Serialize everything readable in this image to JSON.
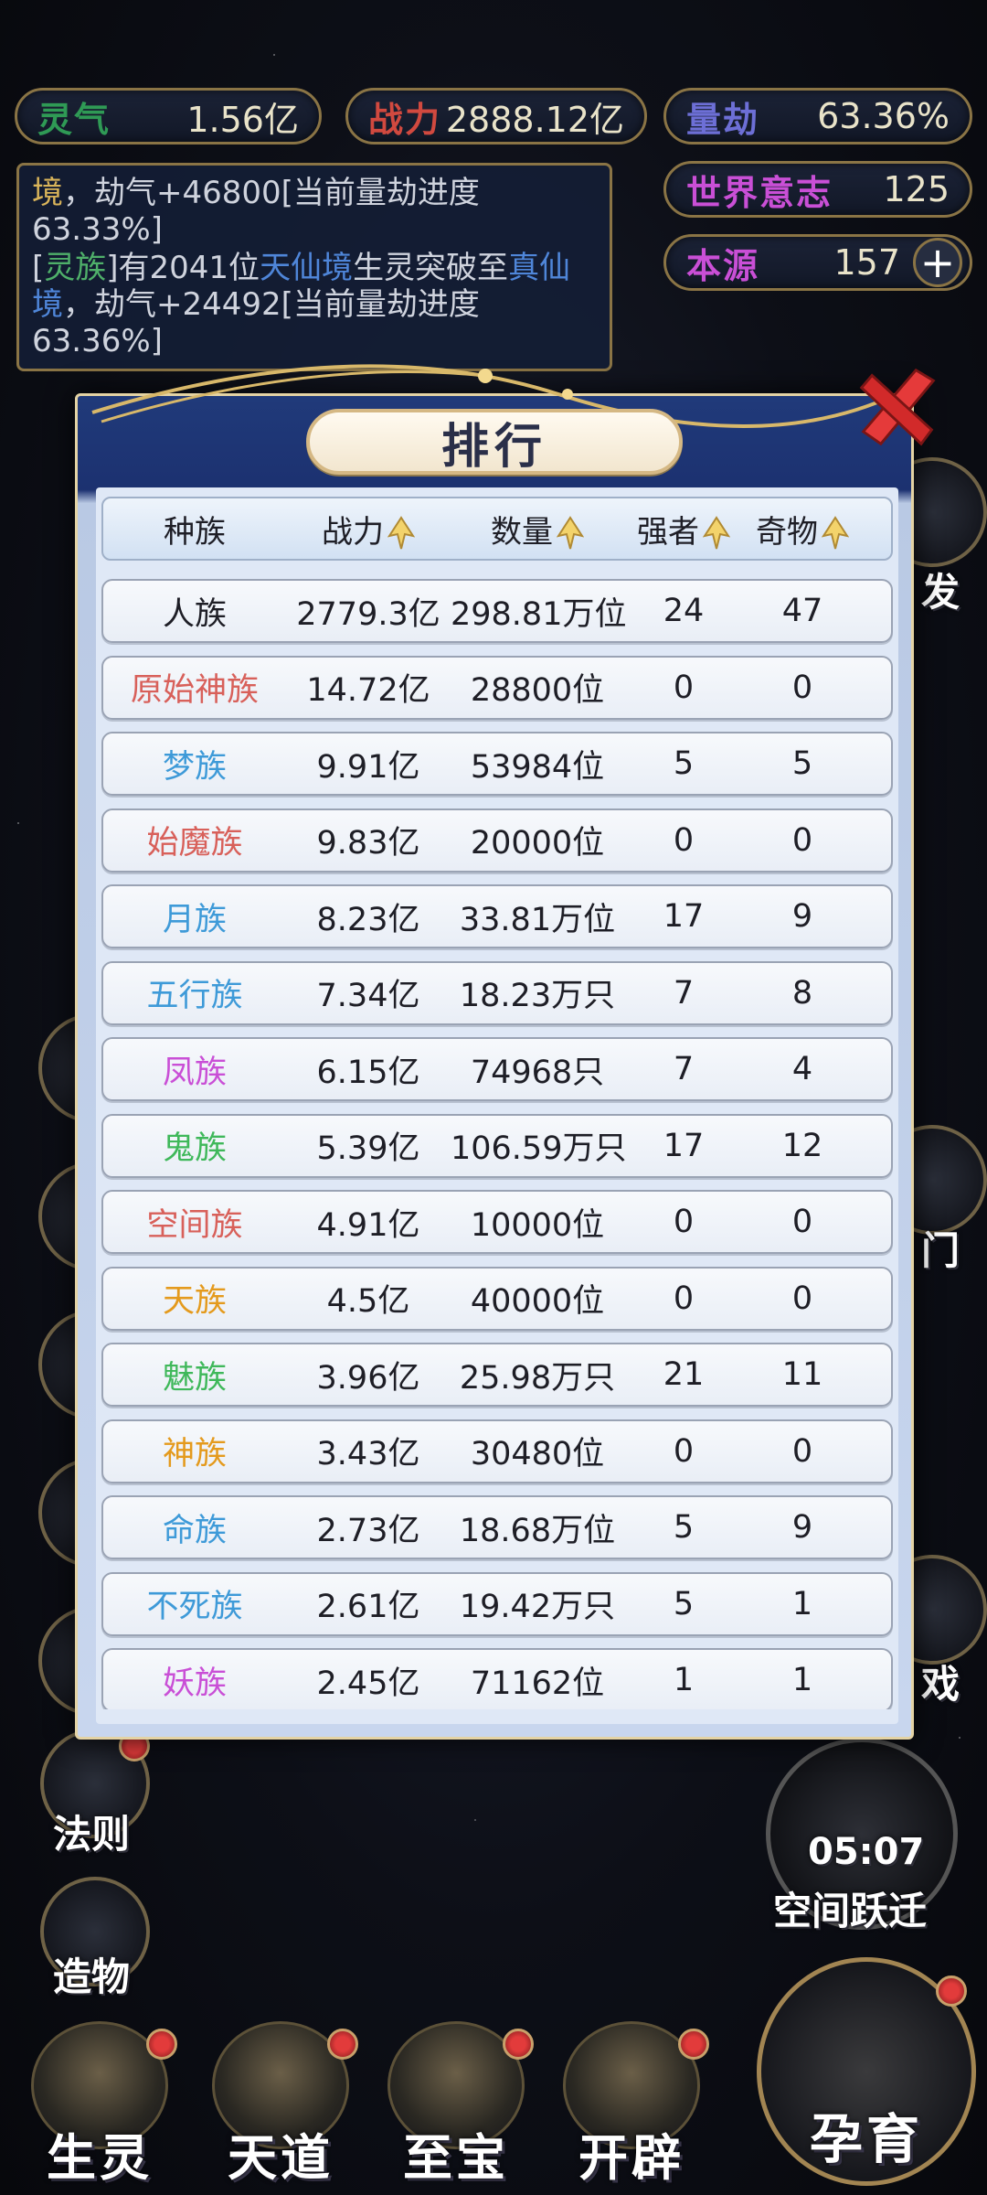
{
  "top_stats": {
    "lingqi": {
      "label": "灵气",
      "value": "1.56亿"
    },
    "zhanli": {
      "label": "战力",
      "value": "2888.12亿"
    },
    "liangjie": {
      "label": "量劫",
      "value": "63.36%"
    },
    "shijie": {
      "label": "世界意志",
      "value": "125"
    },
    "benyuan": {
      "label": "本源",
      "value": "157",
      "plus": "+"
    }
  },
  "log": {
    "line1": {
      "a": "境",
      "b": "，劫气+46800[当前量劫进度63.33%]"
    },
    "line2": {
      "p1": "[",
      "race": "灵族",
      "p2": "]有2041位",
      "realm1": "天仙境",
      "p3": "生灵突破至",
      "realm2": "真仙境",
      "p4": "，劫气+24492[当前量劫进度63.36%]"
    }
  },
  "side": {
    "left_labels": [
      "法则",
      "造物"
    ],
    "right_labels": [
      "发",
      "门",
      "戏"
    ],
    "timer": "05:07",
    "timer_label": "空间跃迁"
  },
  "bottom_nav": {
    "items": [
      "生灵",
      "天道",
      "至宝",
      "开辟"
    ],
    "main": "孕育"
  },
  "ranking": {
    "title": "排行",
    "headers": [
      "种族",
      "战力",
      "数量",
      "强者",
      "奇物"
    ],
    "rows": [
      {
        "race": "人族",
        "color": "#1e1e26",
        "power": "2779.3亿",
        "count": "298.81万位",
        "strong": "24",
        "items": "47"
      },
      {
        "race": "原始神族",
        "color": "#d8605a",
        "power": "14.72亿",
        "count": "28800位",
        "strong": "0",
        "items": "0"
      },
      {
        "race": "梦族",
        "color": "#3e9ad8",
        "power": "9.91亿",
        "count": "53984位",
        "strong": "5",
        "items": "5"
      },
      {
        "race": "始魔族",
        "color": "#d8605a",
        "power": "9.83亿",
        "count": "20000位",
        "strong": "0",
        "items": "0"
      },
      {
        "race": "月族",
        "color": "#3e9ad8",
        "power": "8.23亿",
        "count": "33.81万位",
        "strong": "17",
        "items": "9"
      },
      {
        "race": "五行族",
        "color": "#3e9ad8",
        "power": "7.34亿",
        "count": "18.23万只",
        "strong": "7",
        "items": "8"
      },
      {
        "race": "凤族",
        "color": "#c94fd6",
        "power": "6.15亿",
        "count": "74968只",
        "strong": "7",
        "items": "4"
      },
      {
        "race": "鬼族",
        "color": "#3fb85a",
        "power": "5.39亿",
        "count": "106.59万只",
        "strong": "17",
        "items": "12"
      },
      {
        "race": "空间族",
        "color": "#d8605a",
        "power": "4.91亿",
        "count": "10000位",
        "strong": "0",
        "items": "0"
      },
      {
        "race": "天族",
        "color": "#e49a1d",
        "power": "4.5亿",
        "count": "40000位",
        "strong": "0",
        "items": "0"
      },
      {
        "race": "魅族",
        "color": "#3fb85a",
        "power": "3.96亿",
        "count": "25.98万只",
        "strong": "21",
        "items": "11"
      },
      {
        "race": "神族",
        "color": "#e49a1d",
        "power": "3.43亿",
        "count": "30480位",
        "strong": "0",
        "items": "0"
      },
      {
        "race": "命族",
        "color": "#3e9ad8",
        "power": "2.73亿",
        "count": "18.68万位",
        "strong": "5",
        "items": "9"
      },
      {
        "race": "不死族",
        "color": "#3e9ad8",
        "power": "2.61亿",
        "count": "19.42万只",
        "strong": "5",
        "items": "1"
      },
      {
        "race": "妖族",
        "color": "#c94fd6",
        "power": "2.45亿",
        "count": "71162位",
        "strong": "1",
        "items": "1"
      }
    ]
  },
  "colors": {
    "lingqi_label": "#2f9a55",
    "zhanli_label": "#d1493f",
    "liangjie_label": "#6d6fd6",
    "shijie_label": "#c94fd6",
    "benyuan_label": "#c94fd6"
  }
}
